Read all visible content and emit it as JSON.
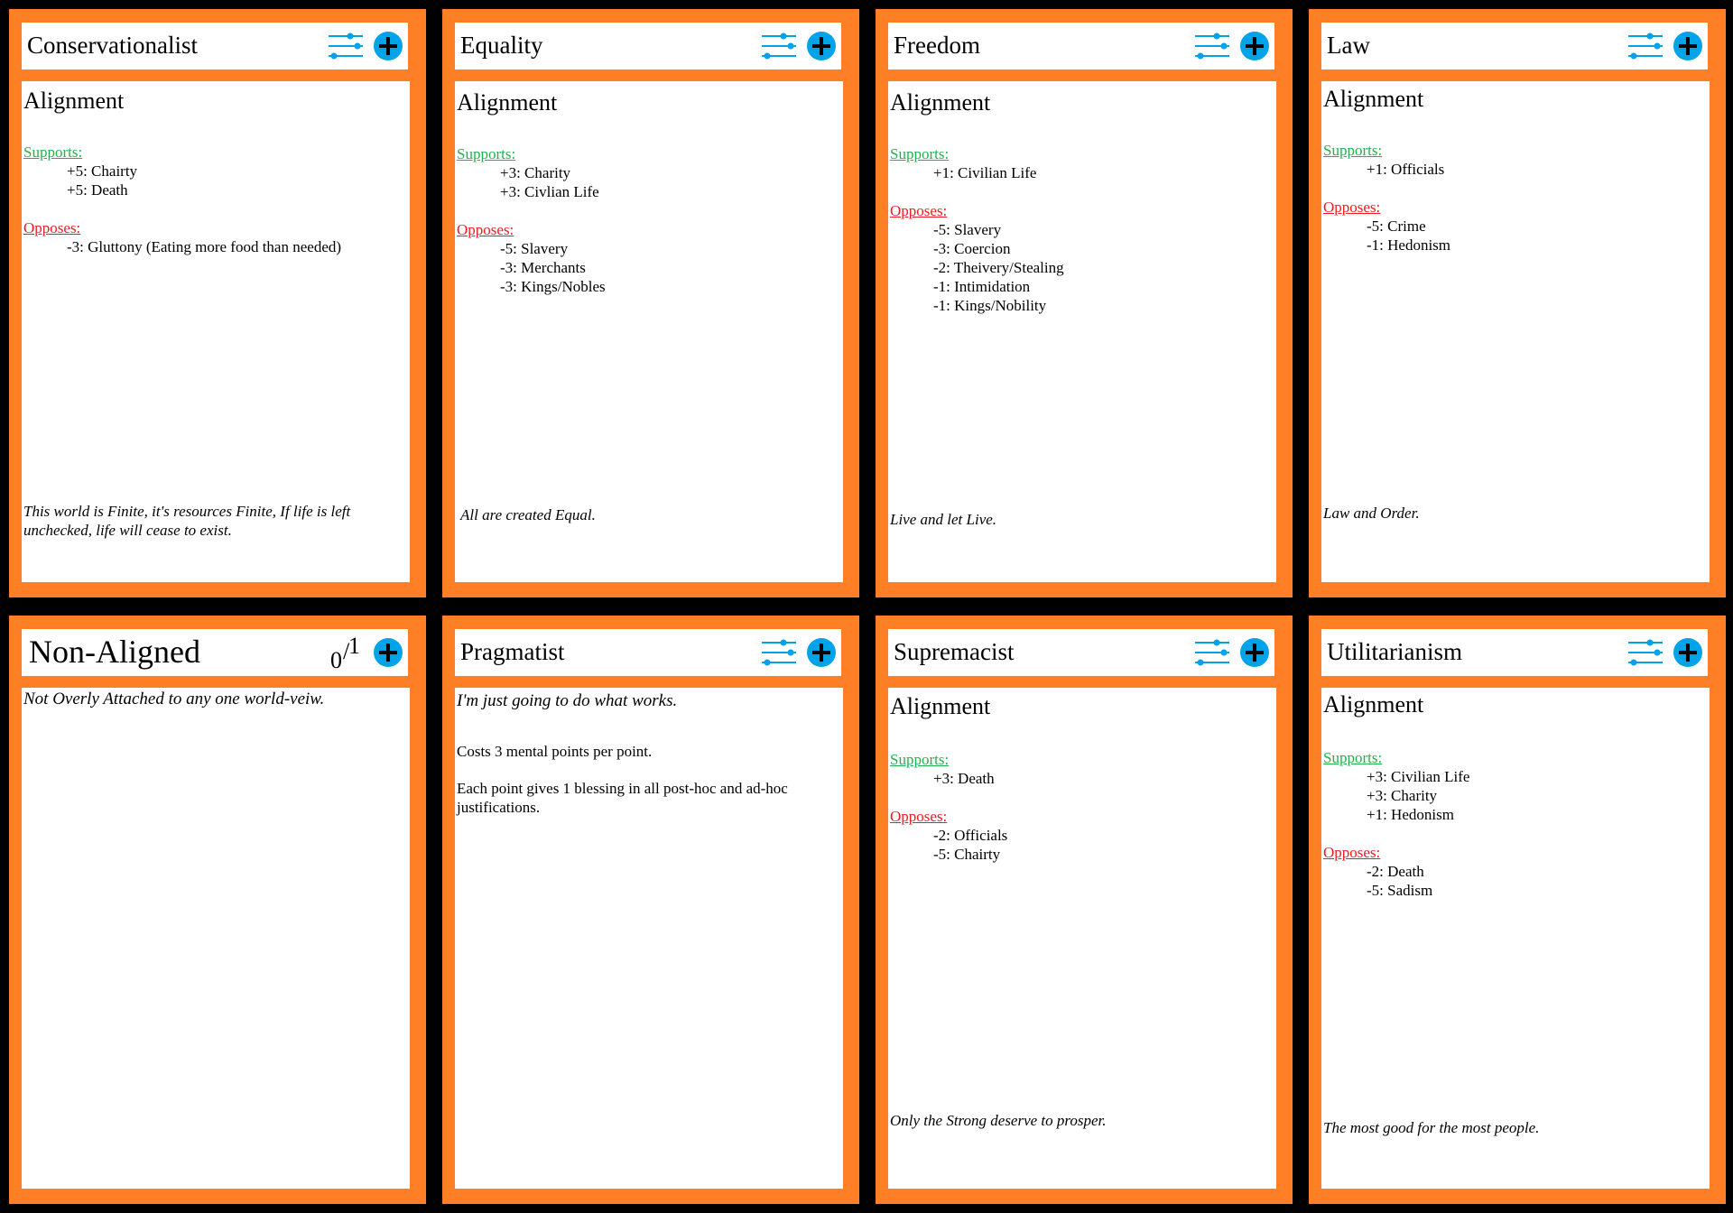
{
  "colors": {
    "card_border": "#ff7f27",
    "supports": "#22b14c",
    "opposes": "#ed1c24",
    "icon_blue": "#00a2e8",
    "background": "#000000"
  },
  "icons": {
    "settings": "sliders-icon",
    "add": "plus-circle-icon"
  },
  "cards": [
    {
      "title": "Conservationalist",
      "heading": "Alignment",
      "supports_label": "Supports:",
      "supports": [
        "+5: Chairty",
        "+5: Death"
      ],
      "opposes_label": "Opposes:",
      "opposes": [
        "-3: Gluttony (Eating more food than needed)"
      ],
      "motto": "This world is Finite, it's resources Finite, If life is left unchecked, life will cease to exist."
    },
    {
      "title": "Equality",
      "heading": "Alignment",
      "supports_label": "Supports:",
      "supports": [
        "+3: Charity",
        "+3: Civlian Life"
      ],
      "opposes_label": "Opposes:",
      "opposes": [
        "-5: Slavery",
        "-3: Merchants",
        "-3: Kings/Nobles"
      ],
      "motto": "All are created Equal."
    },
    {
      "title": "Freedom",
      "heading": "Alignment",
      "supports_label": "Supports:",
      "supports": [
        "+1: Civilian Life"
      ],
      "opposes_label": "Opposes:",
      "opposes": [
        "-5: Slavery",
        "-3: Coercion",
        "-2: Theivery/Stealing",
        "-1: Intimidation",
        "-1: Kings/Nobility"
      ],
      "motto": "Live and let Live."
    },
    {
      "title": "Law",
      "heading": "Alignment",
      "supports_label": "Supports:",
      "supports": [
        "+1: Officials"
      ],
      "opposes_label": "Opposes:",
      "opposes": [
        "-5: Crime",
        "-1: Hedonism"
      ],
      "motto": "Law and Order."
    },
    {
      "title": "Non-Aligned",
      "counter": {
        "low": "0",
        "slash": "/",
        "high": "1"
      },
      "description": "Not Overly Attached to any one world-veiw."
    },
    {
      "title": "Pragmatist",
      "motto": "I'm just going to do what works.",
      "cost": "Costs 3 mental points per point.",
      "effect": "Each point gives 1 blessing in all post-hoc and ad-hoc justifications."
    },
    {
      "title": "Supremacist",
      "heading": "Alignment",
      "supports_label": "Supports:",
      "supports": [
        "+3: Death"
      ],
      "opposes_label": "Opposes:",
      "opposes": [
        "-2: Officials",
        "-5: Chairty"
      ],
      "motto": "Only the Strong deserve to prosper."
    },
    {
      "title": "Utilitarianism",
      "heading": "Alignment",
      "supports_label": "Supports:",
      "supports": [
        "+3: Civilian Life",
        "+3: Charity",
        "+1: Hedonism"
      ],
      "opposes_label": "Opposes:",
      "opposes": [
        "-2: Death",
        "-5: Sadism"
      ],
      "motto": "The most good for the most people."
    }
  ]
}
